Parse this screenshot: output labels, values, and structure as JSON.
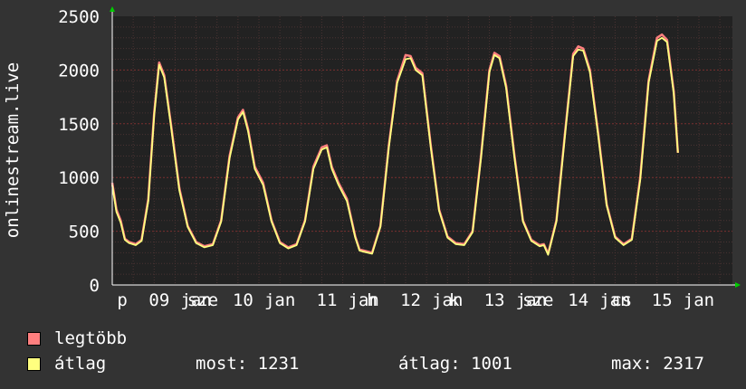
{
  "chart_data": {
    "type": "line",
    "ylabel": "onlinestream.live",
    "ylim": [
      0,
      2500
    ],
    "yticks": [
      0,
      500,
      1000,
      1500,
      2000,
      2500
    ],
    "grid": true,
    "xlim": [
      0,
      7.4
    ],
    "xticks": [
      {
        "label": "p",
        "x": 0.12
      },
      {
        "label": "09",
        "x": 0.56
      },
      {
        "label": "jan",
        "x": 1.0
      },
      {
        "label": "sze",
        "x": 1.08
      },
      {
        "label": "10",
        "x": 1.56
      },
      {
        "label": "jan",
        "x": 2.0
      },
      {
        "label": "11",
        "x": 2.56
      },
      {
        "label": "jan",
        "x": 3.0
      },
      {
        "label": "h",
        "x": 3.1
      },
      {
        "label": "12",
        "x": 3.56
      },
      {
        "label": "jan",
        "x": 4.0
      },
      {
        "label": "k",
        "x": 4.08
      },
      {
        "label": "13",
        "x": 4.56
      },
      {
        "label": "jan",
        "x": 5.0
      },
      {
        "label": "sze",
        "x": 5.08
      },
      {
        "label": "14",
        "x": 5.56
      },
      {
        "label": "jan",
        "x": 6.0
      },
      {
        "label": "cs",
        "x": 6.08
      },
      {
        "label": "15",
        "x": 6.56
      },
      {
        "label": "jan",
        "x": 7.0
      }
    ],
    "series": [
      {
        "name": "legtöbb",
        "color": "#ff7f7f",
        "x": [
          0.0,
          0.05,
          0.1,
          0.15,
          0.2,
          0.28,
          0.35,
          0.43,
          0.5,
          0.56,
          0.62,
          0.7,
          0.8,
          0.9,
          1.0,
          1.1,
          1.2,
          1.3,
          1.4,
          1.5,
          1.56,
          1.62,
          1.7,
          1.8,
          1.9,
          2.0,
          2.1,
          2.2,
          2.3,
          2.4,
          2.5,
          2.56,
          2.62,
          2.7,
          2.8,
          2.9,
          2.95,
          3.0,
          3.1,
          3.2,
          3.3,
          3.4,
          3.5,
          3.56,
          3.62,
          3.7,
          3.8,
          3.9,
          4.0,
          4.1,
          4.2,
          4.3,
          4.4,
          4.5,
          4.56,
          4.62,
          4.7,
          4.8,
          4.9,
          5.0,
          5.1,
          5.15,
          5.2,
          5.3,
          5.4,
          5.5,
          5.56,
          5.62,
          5.7,
          5.8,
          5.9,
          6.0,
          6.1,
          6.2,
          6.3,
          6.4,
          6.5,
          6.56,
          6.62,
          6.7,
          6.75
        ],
        "values": [
          950,
          700,
          600,
          430,
          400,
          380,
          420,
          800,
          1600,
          2070,
          1950,
          1500,
          900,
          550,
          400,
          360,
          380,
          600,
          1200,
          1560,
          1630,
          1450,
          1100,
          950,
          600,
          400,
          350,
          380,
          600,
          1100,
          1280,
          1300,
          1100,
          950,
          800,
          450,
          330,
          320,
          300,
          550,
          1300,
          1900,
          2140,
          2130,
          2020,
          1970,
          1300,
          700,
          450,
          390,
          380,
          500,
          1200,
          2000,
          2160,
          2130,
          1850,
          1200,
          600,
          420,
          370,
          380,
          290,
          600,
          1400,
          2150,
          2220,
          2200,
          2000,
          1400,
          750,
          450,
          380,
          430,
          1000,
          1900,
          2300,
          2330,
          2280,
          1800,
          1230
        ]
      },
      {
        "name": "átlag",
        "color": "#ffff7f",
        "x": [
          0.0,
          0.05,
          0.1,
          0.15,
          0.2,
          0.28,
          0.35,
          0.43,
          0.5,
          0.56,
          0.62,
          0.7,
          0.8,
          0.9,
          1.0,
          1.1,
          1.2,
          1.3,
          1.4,
          1.5,
          1.56,
          1.62,
          1.7,
          1.8,
          1.9,
          2.0,
          2.1,
          2.2,
          2.3,
          2.4,
          2.5,
          2.56,
          2.62,
          2.7,
          2.8,
          2.9,
          2.95,
          3.0,
          3.1,
          3.2,
          3.3,
          3.4,
          3.5,
          3.56,
          3.62,
          3.7,
          3.8,
          3.9,
          4.0,
          4.1,
          4.2,
          4.3,
          4.4,
          4.5,
          4.56,
          4.62,
          4.7,
          4.8,
          4.9,
          5.0,
          5.1,
          5.15,
          5.2,
          5.3,
          5.4,
          5.5,
          5.56,
          5.62,
          5.7,
          5.8,
          5.9,
          6.0,
          6.1,
          6.2,
          6.3,
          6.4,
          6.5,
          6.56,
          6.62,
          6.7,
          6.75
        ],
        "values": [
          930,
          680,
          580,
          420,
          390,
          370,
          410,
          780,
          1580,
          2050,
          1930,
          1480,
          880,
          540,
          390,
          350,
          370,
          590,
          1180,
          1540,
          1610,
          1430,
          1080,
          930,
          590,
          390,
          340,
          370,
          590,
          1080,
          1260,
          1280,
          1080,
          930,
          780,
          440,
          320,
          310,
          290,
          540,
          1280,
          1880,
          2100,
          2110,
          2000,
          1950,
          1280,
          690,
          440,
          380,
          370,
          490,
          1180,
          1980,
          2140,
          2110,
          1830,
          1180,
          590,
          410,
          360,
          370,
          280,
          590,
          1380,
          2130,
          2190,
          2180,
          1980,
          1380,
          740,
          440,
          370,
          420,
          980,
          1880,
          2270,
          2300,
          2260,
          1780,
          1231
        ]
      }
    ]
  },
  "legend": [
    {
      "label": "legtöbb",
      "color": "#ff7f7f"
    },
    {
      "label": "átlag",
      "color": "#ffff7f"
    }
  ],
  "stats": {
    "most": "most: 1231",
    "atlag": "átlag: 1001",
    "max": "max: 2317"
  }
}
